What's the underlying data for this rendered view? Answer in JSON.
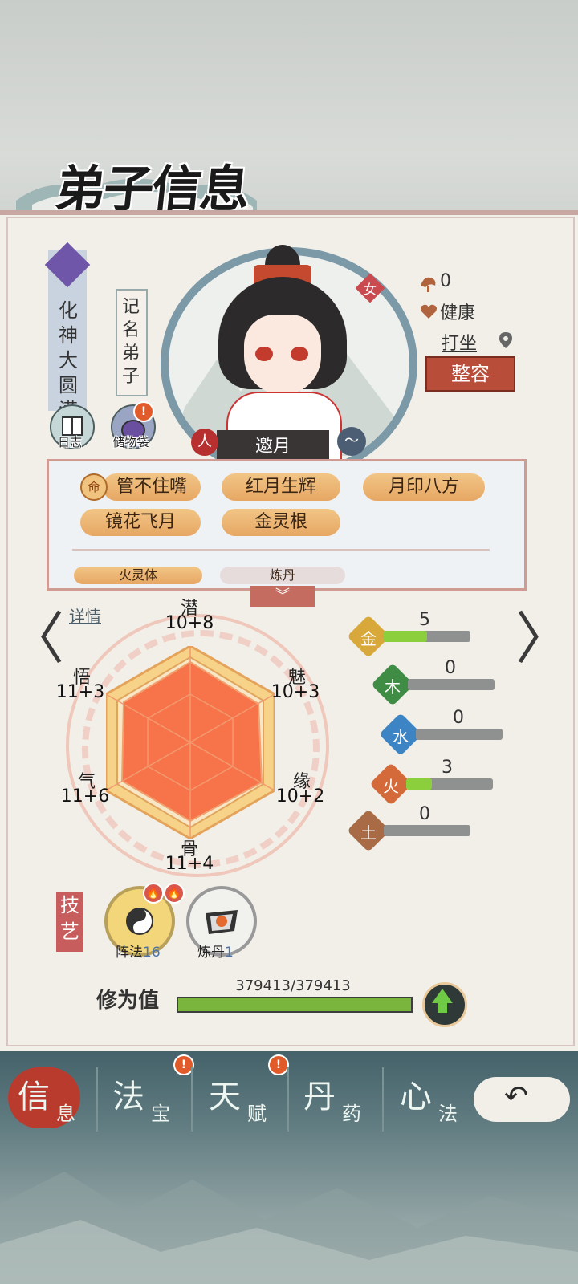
{
  "header": {
    "title": "弟子信息"
  },
  "disciple": {
    "realm": "化神大圆满",
    "rank": "记名弟子",
    "name": "邀月",
    "gender": "女",
    "race": "人",
    "mood_count": "0",
    "health": "健康",
    "activity": "打坐",
    "makeover_label": "整容"
  },
  "buttons": {
    "log": "日志",
    "bag": "储物袋",
    "bag_badge": "!"
  },
  "traits": {
    "fate_icon": "命",
    "items": [
      "管不住嘴",
      "红月生辉",
      "月印八方",
      "镜花飞月",
      "金灵根"
    ],
    "partial": [
      "火灵体",
      "炼丹"
    ]
  },
  "detail_label": "详情",
  "stats": {
    "qian": {
      "name": "潜",
      "value": "10+8"
    },
    "mei": {
      "name": "魅",
      "value": "10+3"
    },
    "yuan": {
      "name": "缘",
      "value": "10+2"
    },
    "gu": {
      "name": "骨",
      "value": "11+4"
    },
    "qi": {
      "name": "气",
      "value": "11+6"
    },
    "wu": {
      "name": "悟",
      "value": "11+3"
    }
  },
  "elements": [
    {
      "char": "金",
      "value": "5",
      "color": "#d8a93a",
      "fill": 0.5
    },
    {
      "char": "木",
      "value": "0",
      "color": "#3f8d44",
      "fill": 0
    },
    {
      "char": "水",
      "value": "0",
      "color": "#3d84c4",
      "fill": 0
    },
    {
      "char": "火",
      "value": "3",
      "color": "#d46a3a",
      "fill": 0.3
    },
    {
      "char": "土",
      "value": "0",
      "color": "#a86b45",
      "fill": 0
    }
  ],
  "skills": {
    "tag": "技艺",
    "array": {
      "name": "阵法",
      "level": "16"
    },
    "alchemy": {
      "name": "炼丹",
      "level": "1"
    }
  },
  "cultivation": {
    "label": "修为值",
    "value": "379413/379413",
    "fill": 1.0
  },
  "tabs": [
    {
      "main": "信",
      "sub": "息"
    },
    {
      "main": "法",
      "sub": "宝"
    },
    {
      "main": "天",
      "sub": "赋"
    },
    {
      "main": "丹",
      "sub": "药"
    },
    {
      "main": "心",
      "sub": "法"
    }
  ],
  "tab_badge": "!",
  "nav": {
    "prev": "〈",
    "next": "〉",
    "back": "↶",
    "more": "︾"
  }
}
